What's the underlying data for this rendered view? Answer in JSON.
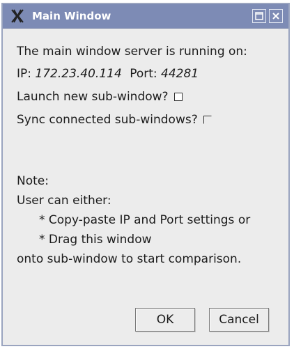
{
  "window": {
    "title": "Main Window",
    "icons": {
      "app": "x-logo-icon",
      "maximize": "maximize-icon",
      "close": "close-icon"
    }
  },
  "content": {
    "server_line": "The main window server is running on:",
    "ip_label": "IP:",
    "ip_value": "172.23.40.114",
    "port_label": "Port:",
    "port_value": "44281",
    "launch_label": "Launch new sub-window?",
    "sync_label": "Sync connected sub-windows?",
    "note_title": "Note:",
    "note_intro": "User can either:",
    "note_item_1": "* Copy-paste IP and Port settings or",
    "note_item_2": "* Drag this window",
    "note_outro": "onto sub-window to start comparison."
  },
  "buttons": {
    "ok": "OK",
    "cancel": "Cancel"
  }
}
